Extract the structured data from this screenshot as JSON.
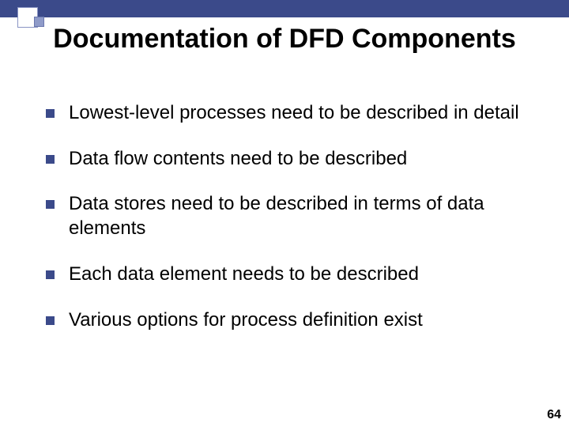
{
  "slide": {
    "title": "Documentation of DFD Components",
    "bullets": [
      "Lowest-level processes need to be described in detail",
      "Data flow contents need to be described",
      "Data stores need to be described in terms of data elements",
      "Each data element needs to be described",
      "Various options for process definition exist"
    ],
    "pageNumber": "64"
  }
}
